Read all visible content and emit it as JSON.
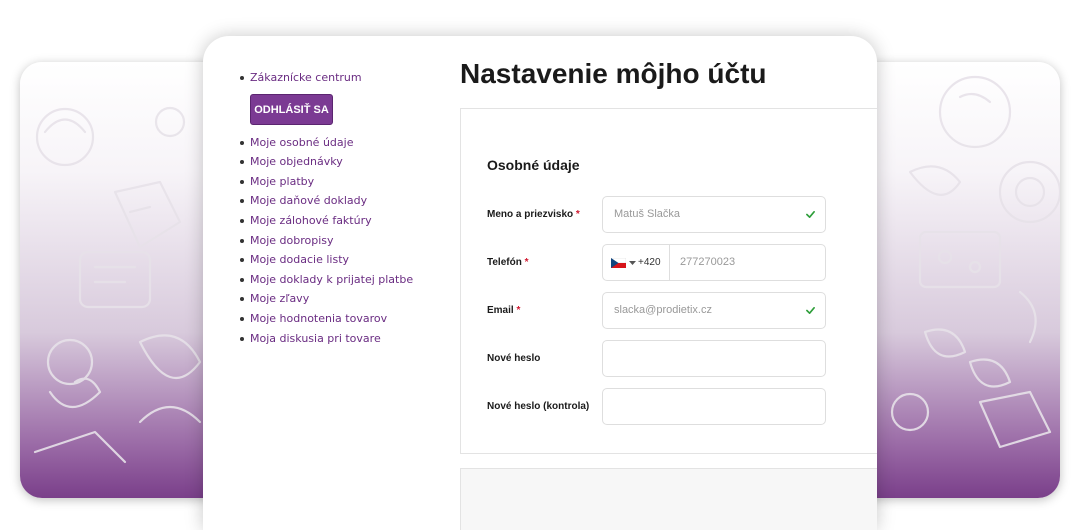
{
  "sidebar": {
    "customer_center": "Zákaznícke centrum",
    "logout_label": "ODHLÁSIŤ SA",
    "items": [
      {
        "label": "Moje osobné údaje"
      },
      {
        "label": "Moje objednávky"
      },
      {
        "label": "Moje platby"
      },
      {
        "label": "Moje daňové doklady"
      },
      {
        "label": "Moje zálohové faktúry"
      },
      {
        "label": "Moje dobropisy"
      },
      {
        "label": "Moje dodacie listy"
      },
      {
        "label": "Moje doklady k prijatej platbe"
      },
      {
        "label": "Moje zľavy"
      },
      {
        "label": "Moje hodnotenia tovarov"
      },
      {
        "label": "Moja diskusia pri tovare"
      }
    ]
  },
  "main": {
    "title": "Nastavenie môjho účtu",
    "section_title": "Osobné údaje",
    "fields": {
      "name": {
        "label": "Meno a priezvisko",
        "required": "*",
        "value": "Matuš Slačka"
      },
      "phone": {
        "label": "Telefón",
        "required": "*",
        "dial_code": "+420",
        "value": "277270023",
        "country_icon": "czech-flag-icon"
      },
      "email": {
        "label": "Email",
        "required": "*",
        "value": "slacka@prodietix.cz"
      },
      "new_password": {
        "label": "Nové heslo",
        "value": ""
      },
      "new_password_confirm": {
        "label": "Nové heslo (kontrola)",
        "value": ""
      }
    }
  },
  "colors": {
    "accent": "#7b3a93",
    "link": "#6a2c82",
    "required": "#d0182f",
    "valid_check": "#2e9e3a"
  }
}
